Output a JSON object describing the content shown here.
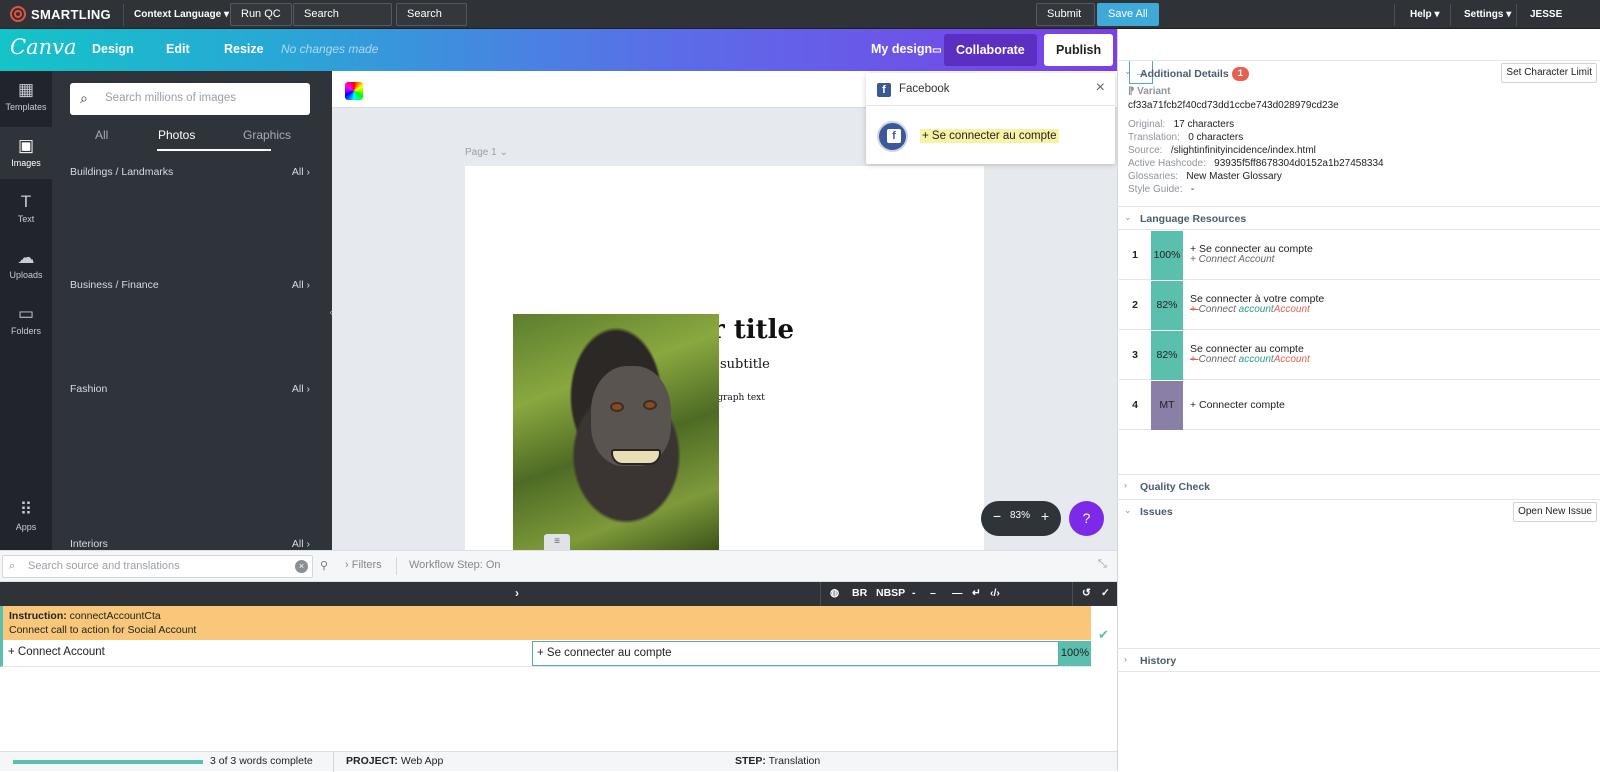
{
  "smartling": {
    "logo": "SMARTLING",
    "context_language": "Context Language",
    "run_qc": "Run QC",
    "search_glossary": "Search Glossary",
    "search_tm": "Search TM",
    "submit": "Submit",
    "save_all": "Save All",
    "help": "Help",
    "settings": "Settings",
    "user": "JESSE WALKER"
  },
  "canva": {
    "logo": "Canva",
    "menu": [
      "Design",
      "Edit",
      "Resize"
    ],
    "status": "No changes made",
    "my_design": "My design",
    "collaborate": "Collaborate",
    "publish": "Publish"
  },
  "rail": [
    {
      "label": "Templates",
      "icon": "templates-icon"
    },
    {
      "label": "Images",
      "icon": "images-icon"
    },
    {
      "label": "Text",
      "icon": "text-icon"
    },
    {
      "label": "Uploads",
      "icon": "uploads-icon"
    },
    {
      "label": "Folders",
      "icon": "folders-icon"
    },
    {
      "label": "Apps",
      "icon": "apps-icon"
    }
  ],
  "panel": {
    "search_placeholder": "Search millions of images",
    "tabs": [
      "All",
      "Photos",
      "Graphics"
    ],
    "active_tab": "Photos",
    "categories": [
      "Buildings / Landmarks",
      "Business / Finance",
      "Fashion",
      "Interiors"
    ],
    "all_label": "All"
  },
  "canvas": {
    "page_label": "Page 1",
    "title": "r title",
    "subtitle": "subtitle",
    "paragraph": "agraph text",
    "zoom": "83%",
    "help": "?"
  },
  "facebook_popup": {
    "title": "Facebook",
    "button_text": "+ Se connecter au compte"
  },
  "editor": {
    "search_placeholder": "Search source and translations",
    "filters": "Filters",
    "workflow_step": "Workflow Step: On",
    "toolbar": [
      "BR",
      "NBSP"
    ],
    "instruction_label": "Instruction:",
    "instruction_key": "connectAccountCta",
    "instruction_text": "Connect call to action for Social Account",
    "source": "+ Connect Account",
    "target": "+ Se connecter au compte",
    "match_pct": "100%"
  },
  "status": {
    "words_complete": "3 of 3 words complete",
    "progress": 1.0,
    "project_label": "PROJECT:",
    "project": "Web App",
    "step_label": "STEP:",
    "step": "Translation"
  },
  "details": {
    "section_title": "Additional Details",
    "badge": "1",
    "set_char_limit": "Set Character Limit",
    "variant_label": "Variant",
    "variant_hash": "cf33a71fcb2f40cd73dd1ccbe743d028979cd23e",
    "rows": [
      {
        "label": "Original:",
        "value": "17 characters"
      },
      {
        "label": "Translation:",
        "value": "0 characters"
      },
      {
        "label": "Source:",
        "value": "/slightinfinityincidence/index.html"
      },
      {
        "label": "Active Hashcode:",
        "value": "93935f5ff8678304d0152a1b27458334"
      },
      {
        "label": "Glossaries:",
        "value": "New Master Glossary"
      },
      {
        "label": "Style Guide:",
        "value": "-"
      }
    ]
  },
  "language_resources": {
    "title": "Language Resources",
    "items": [
      {
        "num": "1",
        "pct": "100%",
        "text": "+ Se connecter au compte",
        "src_a": "+ Connect Account",
        "src_del": "",
        "src_ins": "",
        "src_ins2": ""
      },
      {
        "num": "2",
        "pct": "82%",
        "text": "Se connecter à votre compte",
        "src_a": "",
        "src_del": "+ ",
        "src_b": "Connect ",
        "src_ins": "account",
        "src_ins2": "Account"
      },
      {
        "num": "3",
        "pct": "82%",
        "text": "Se connecter au compte",
        "src_a": "",
        "src_del": "+ ",
        "src_b": "Connect ",
        "src_ins": "account",
        "src_ins2": "Account"
      },
      {
        "num": "4",
        "pct": "MT",
        "text": "+ Connecter compte",
        "src_a": "",
        "src_del": "",
        "src_ins": "",
        "src_ins2": ""
      }
    ]
  },
  "sections": {
    "quality_check": "Quality Check",
    "issues": "Issues",
    "open_new_issue": "Open New Issue",
    "history": "History"
  },
  "colors": {
    "accent_teal": "#5bbfae",
    "smartling_blue": "#3fa9d8",
    "canva_purple": "#7d2ae8",
    "instruction_bg": "#f9c77a"
  }
}
